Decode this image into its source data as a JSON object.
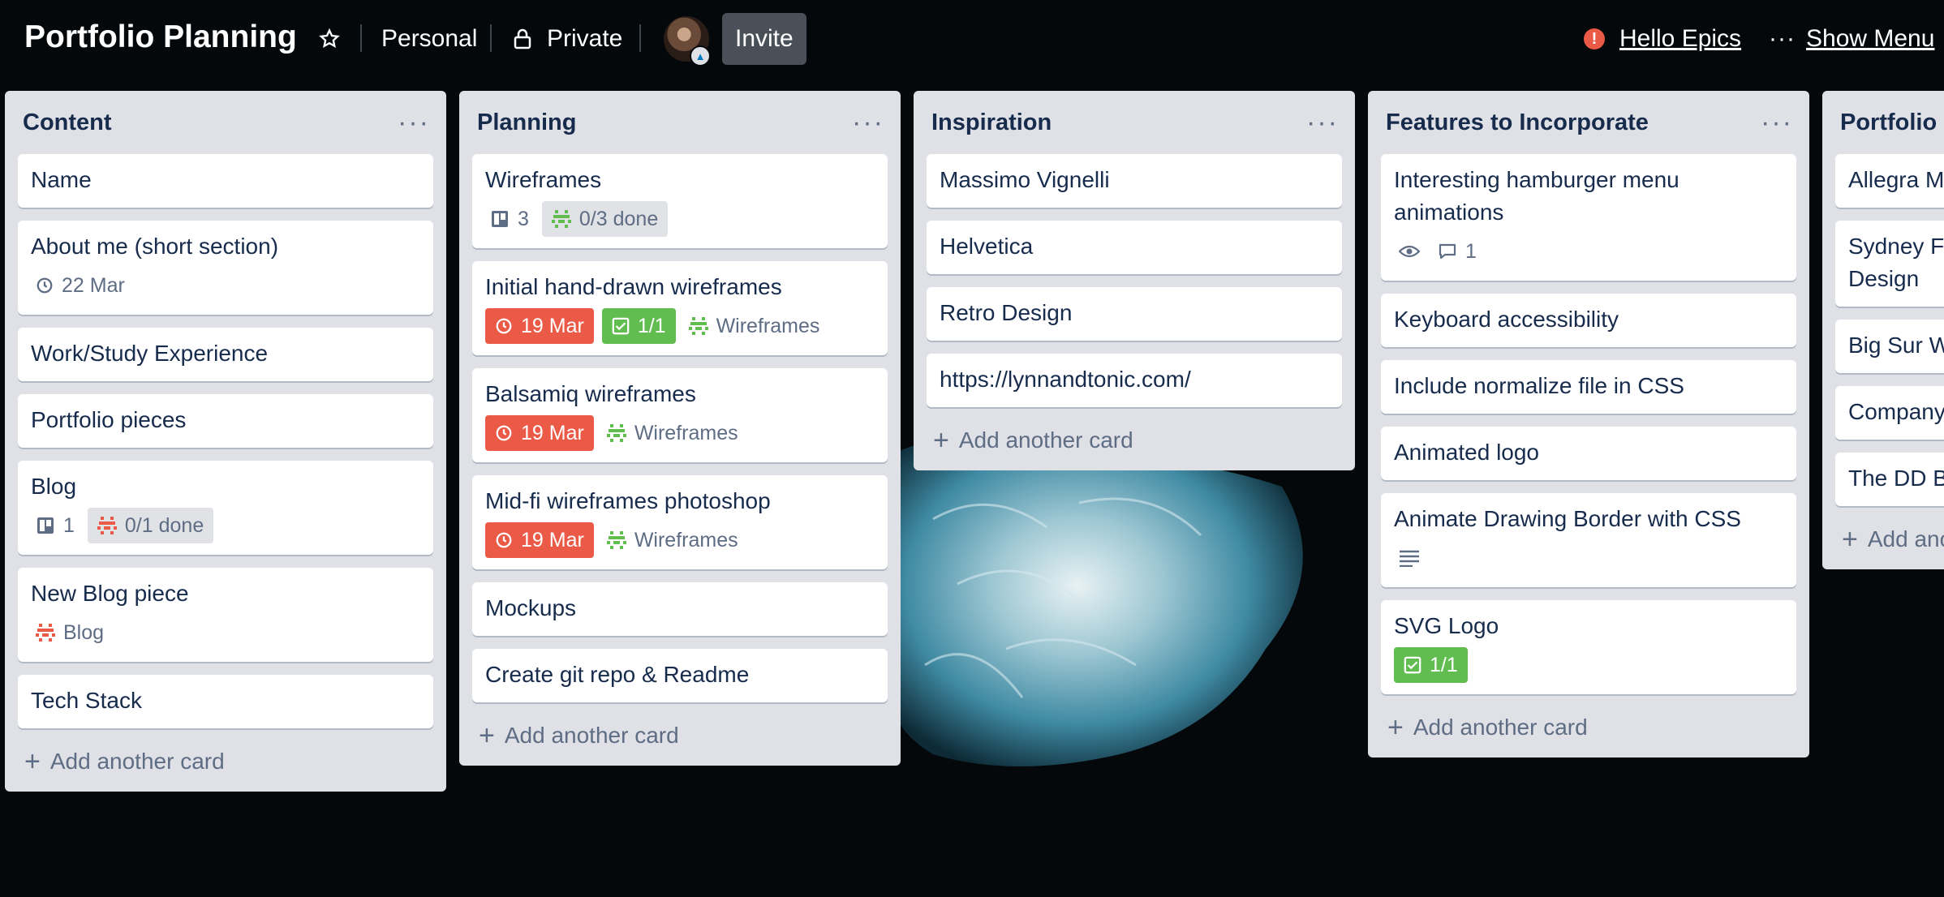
{
  "header": {
    "board_title": "Portfolio Planning",
    "star_icon": "star-icon",
    "workspace_label": "Personal",
    "visibility_label": "Private",
    "invite_label": "Invite",
    "notification_label": "Hello Epics",
    "more_icon": "ellipsis-icon",
    "show_menu_label": "Show Menu"
  },
  "add_card_label": "Add another card",
  "lists": [
    {
      "title": "Content",
      "cards": [
        {
          "title": "Name"
        },
        {
          "title": "About me (short section)",
          "due": "22 Mar"
        },
        {
          "title": "Work/Study Experience"
        },
        {
          "title": "Portfolio pieces"
        },
        {
          "title": "Blog",
          "subtask_count": "1",
          "checklist": "0/1 done"
        },
        {
          "title": "New Blog piece",
          "parent": "Blog"
        },
        {
          "title": "Tech Stack"
        }
      ]
    },
    {
      "title": "Planning",
      "cards": [
        {
          "title": "Wireframes",
          "subtask_count": "3",
          "checklist": "0/3 done"
        },
        {
          "title": "Initial hand-drawn wireframes",
          "due": "19 Mar",
          "checklist_done": "1/1",
          "parent": "Wireframes"
        },
        {
          "title": "Balsamiq wireframes",
          "due": "19 Mar",
          "parent": "Wireframes"
        },
        {
          "title": "Mid-fi wireframes photoshop",
          "due": "19 Mar",
          "parent": "Wireframes"
        },
        {
          "title": "Mockups"
        },
        {
          "title": "Create git repo & Readme"
        }
      ]
    },
    {
      "title": "Inspiration",
      "cards": [
        {
          "title": "Massimo Vignelli"
        },
        {
          "title": "Helvetica"
        },
        {
          "title": "Retro Design"
        },
        {
          "title": "https://lynnandtonic.com/"
        }
      ]
    },
    {
      "title": "Features to Incorporate",
      "cards": [
        {
          "title": "Interesting hamburger menu animations",
          "comments": "1"
        },
        {
          "title": "Keyboard accessibility"
        },
        {
          "title": "Include normalize file in CSS"
        },
        {
          "title": "Animated logo"
        },
        {
          "title": "Animate Drawing Border with CSS"
        },
        {
          "title": "SVG Logo",
          "checklist_done": "1/1"
        }
      ]
    },
    {
      "title": "Portfolio",
      "cards": [
        {
          "title": "Allegra M"
        },
        {
          "title": "Sydney F",
          "line2": "Design"
        },
        {
          "title": "Big Sur W"
        },
        {
          "title": "Company"
        },
        {
          "title": "The DD B"
        }
      ],
      "add_label": "Add ano"
    }
  ],
  "colors": {
    "background": "#05080a",
    "list_bg": "#dfe1e6",
    "due_red": "#eb5a46",
    "done_green": "#61bd4f",
    "flower": "#5fa3b8"
  }
}
